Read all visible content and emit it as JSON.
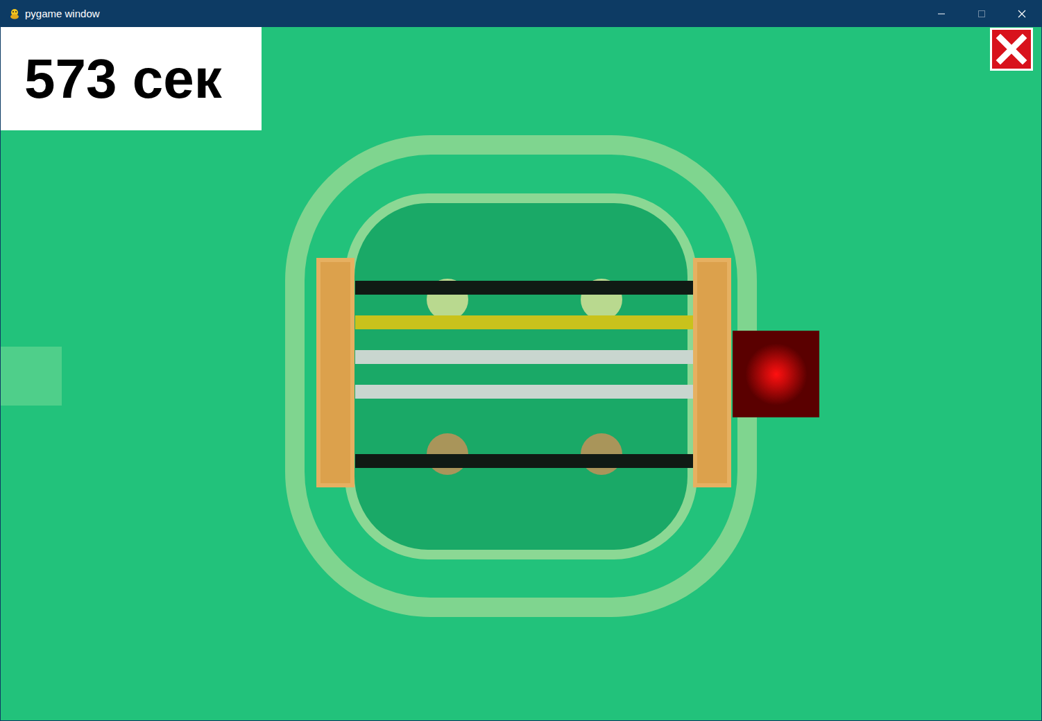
{
  "window": {
    "title": "pygame window"
  },
  "timer": {
    "text": "573 сек"
  },
  "wires": [
    {
      "color": "#101a14",
      "cut": false
    },
    {
      "color": "#c9c21c",
      "cut": false
    },
    {
      "color": "#c9d6cf",
      "cut": false
    },
    {
      "color": "#c9d6cf",
      "cut": false
    },
    {
      "cut": true
    },
    {
      "color": "#101a14",
      "cut": false
    }
  ],
  "indicator": {
    "lit": true,
    "color": "#ff1010"
  }
}
